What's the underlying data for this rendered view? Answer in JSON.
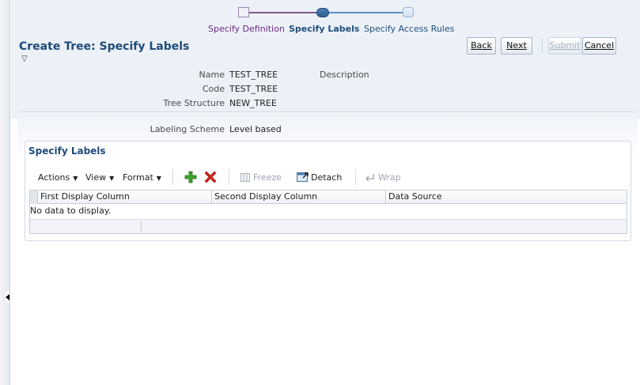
{
  "train": {
    "steps": [
      {
        "label": "Specify Definition",
        "state": "visited"
      },
      {
        "label": "Specify Labels",
        "state": "current"
      },
      {
        "label": "Specify Access Rules",
        "state": "future"
      }
    ]
  },
  "header": {
    "title": "Create Tree: Specify Labels",
    "disclose_icon": "triangle-down-icon",
    "buttons": {
      "back": "Back",
      "next": "Next",
      "submit": "Submit",
      "cancel": "Cancel"
    }
  },
  "summary": {
    "name_label": "Name",
    "name_value": "TEST_TREE",
    "code_label": "Code",
    "code_value": "TEST_TREE",
    "structure_label": "Tree Structure",
    "structure_value": "NEW_TREE",
    "description_label": "Description"
  },
  "labeling": {
    "scheme_label": "Labeling Scheme",
    "scheme_value": "Level based"
  },
  "specify_labels": {
    "title": "Specify Labels",
    "toolbar": {
      "actions": "Actions",
      "view": "View",
      "format": "Format",
      "add_icon": "plus-icon",
      "delete_icon": "x-icon",
      "freeze": "Freeze",
      "detach": "Detach",
      "wrap": "Wrap"
    },
    "columns": [
      "First Display Column",
      "Second Display Column",
      "Data Source"
    ],
    "empty_text": "No data to display."
  },
  "colors": {
    "title_blue": "#1e4b7a",
    "visited_purple": "#6b2a7d",
    "header_band": "#ecf1f8",
    "add_green": "#3aa52c",
    "delete_red": "#d0281d"
  }
}
